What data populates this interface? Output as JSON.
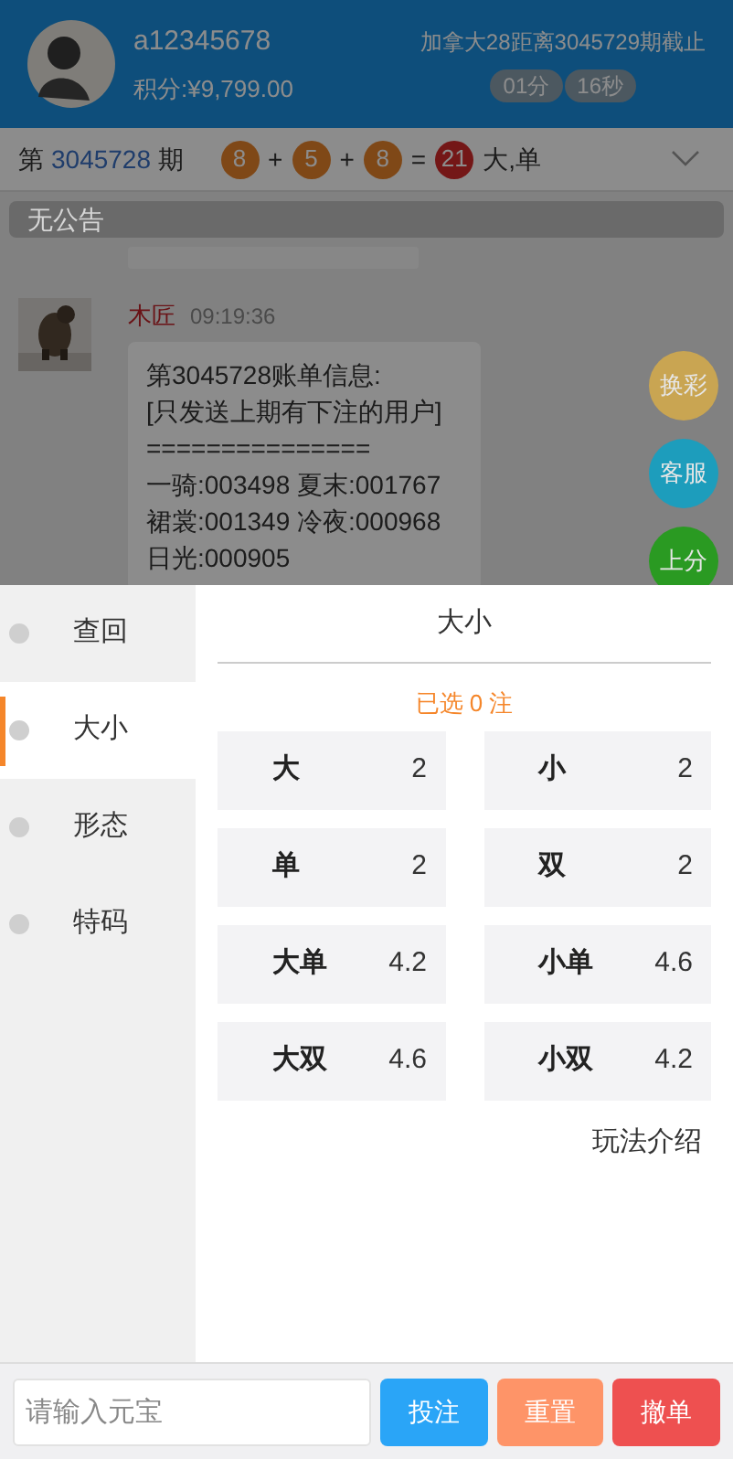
{
  "header": {
    "username": "a12345678",
    "points": "积分:¥9,799.00",
    "countdown_label": "加拿大28距离3045729期截止",
    "minutes": "01分",
    "seconds": "16秒"
  },
  "period_bar": {
    "prefix": "第",
    "period": "3045728",
    "suffix": "期",
    "tokens": [
      {
        "text": "8",
        "kind": "ball"
      },
      {
        "text": "+",
        "kind": "operator"
      },
      {
        "text": "5",
        "kind": "ball"
      },
      {
        "text": "+",
        "kind": "operator"
      },
      {
        "text": "8",
        "kind": "ball"
      },
      {
        "text": "=",
        "kind": "operator"
      },
      {
        "text": "21",
        "kind": "sum"
      }
    ],
    "result": "大,单"
  },
  "announcement": "无公告",
  "messages": [
    {
      "sender": "木匠",
      "time": "09:19:36",
      "lines": [
        "第3045728账单信息:",
        "[只发送上期有下注的用户]",
        "===============",
        "一骑:003498 夏末:001767",
        "裙裳:001349 冷夜:000968",
        "日光:000905"
      ]
    }
  ],
  "float_buttons": [
    {
      "label": "换彩",
      "color": "#c9a552"
    },
    {
      "label": "客服",
      "color": "#1d9dbc"
    },
    {
      "label": "上分",
      "color": "#2a9a22"
    }
  ],
  "categories": [
    {
      "label": "查回",
      "selected": false
    },
    {
      "label": "大小",
      "selected": true
    },
    {
      "label": "形态",
      "selected": false
    },
    {
      "label": "特码",
      "selected": false
    }
  ],
  "panel": {
    "title": "大小",
    "selected_count": "已选 0 注",
    "options": [
      {
        "label": "大",
        "odds": "2"
      },
      {
        "label": "小",
        "odds": "2"
      },
      {
        "label": "单",
        "odds": "2"
      },
      {
        "label": "双",
        "odds": "2"
      },
      {
        "label": "大单",
        "odds": "4.2"
      },
      {
        "label": "小单",
        "odds": "4.6"
      },
      {
        "label": "大双",
        "odds": "4.6"
      },
      {
        "label": "小双",
        "odds": "4.2"
      }
    ],
    "rules_link": "玩法介绍"
  },
  "bet_bar": {
    "placeholder": "请输入元宝",
    "buttons": [
      {
        "label": "投注",
        "kind": "submit"
      },
      {
        "label": "重置",
        "kind": "reset"
      },
      {
        "label": "撤单",
        "kind": "cancel"
      }
    ]
  }
}
